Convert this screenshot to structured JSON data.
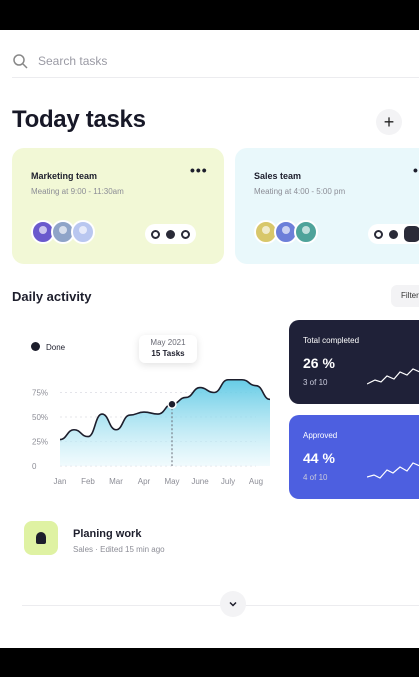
{
  "search": {
    "placeholder": "Search tasks",
    "icon": "search-icon"
  },
  "header": {
    "title": "Today tasks",
    "add_label": "+"
  },
  "teams": [
    {
      "name": "Marketing team",
      "meeting": "Meating at 9:00 - 11:30am",
      "more": "•••",
      "bg": "#f2f8d6",
      "avatar_colors": [
        "#6a5acd",
        "#8fa4c8",
        "#b9c7f0"
      ]
    },
    {
      "name": "Sales team",
      "meeting": "Meating at 4:00 - 5:00 pm",
      "more": "•••",
      "bg": "#e9f8fb",
      "avatar_colors": [
        "#d8c76a",
        "#6d7fd9",
        "#4fa39a"
      ]
    }
  ],
  "activity": {
    "title": "Daily activity",
    "filter_label": "Filter",
    "legend": "Done",
    "tooltip": {
      "month": "May 2021",
      "value": "15 Tasks"
    }
  },
  "chart_data": {
    "type": "area",
    "categories": [
      "Jan",
      "Feb",
      "Mar",
      "Apr",
      "May",
      "June",
      "July",
      "Aug"
    ],
    "x": [
      0,
      0.5,
      1,
      1.5,
      2,
      2.5,
      3,
      3.5,
      4,
      4.5,
      5,
      5.5,
      6,
      6.5,
      7,
      7.5
    ],
    "values": [
      27,
      37,
      30,
      53,
      37,
      52,
      55,
      53,
      63,
      70,
      80,
      75,
      88,
      88,
      82,
      68
    ],
    "yticks": [
      "0",
      "25%",
      "50%",
      "75%"
    ],
    "ylim": [
      0,
      100
    ],
    "series_name": "Done",
    "highlight_index": 8,
    "colors": {
      "line": "#1d1e2c",
      "fill_top": "#55c6e3",
      "fill_bottom": "#e8f8fc"
    }
  },
  "stats": [
    {
      "label": "Total completed",
      "value": "26 %",
      "sub": "3 of 10",
      "bg": "#1f2138"
    },
    {
      "label": "Approved",
      "value": "44 %",
      "sub": "4 of 10",
      "bg": "#4d5fe0"
    }
  ],
  "task": {
    "title": "Planing work",
    "subtitle": "Sales · Edited 15 min ago",
    "icon_bg": "#dff2a3"
  }
}
